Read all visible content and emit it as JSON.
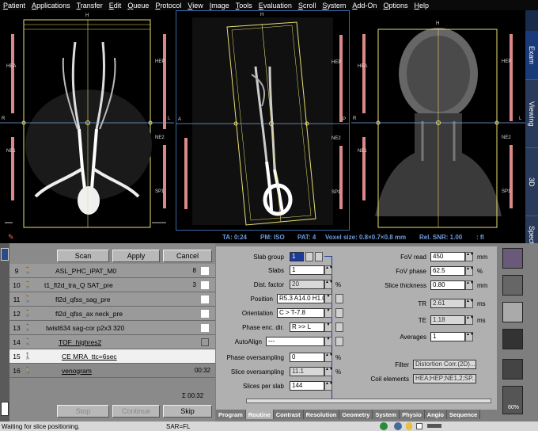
{
  "menu": [
    "Patient",
    "Applications",
    "Transfer",
    "Edit",
    "Queue",
    "Protocol",
    "View",
    "Image",
    "Tools",
    "Evaluation",
    "Scroll",
    "System",
    "Add-On",
    "Options",
    "Help"
  ],
  "viewports": [
    {
      "top_label": "H",
      "left_labels": [
        "HEA",
        "NE1"
      ],
      "right_labels": [
        "HEP",
        "NE2",
        "SP1"
      ],
      "side_labels": [
        "R",
        "L"
      ]
    },
    {
      "top_label": "H",
      "left_labels": [
        "A"
      ],
      "right_labels": [
        "HEP",
        "NE2",
        "SP1"
      ],
      "side_labels": [
        "A",
        "P"
      ]
    },
    {
      "top_label": "H",
      "left_labels": [
        "HEA",
        "NE1"
      ],
      "right_labels": [
        "HEP",
        "NE2",
        "SP1"
      ],
      "side_labels": [
        "R",
        "L"
      ]
    }
  ],
  "side_tabs": [
    "Exam",
    "Viewing",
    "3D",
    "Spectroscopy"
  ],
  "info": {
    "ta": "TA: 0:24",
    "pm": "PM: ISO",
    "pat": "PAT: 4",
    "voxel": "Voxel size: 0.8×0.7×0.8 mm",
    "snr": "Rel. SNR: 1.00",
    "mode": ": fl"
  },
  "queue": {
    "buttons": {
      "scan": "Scan",
      "apply": "Apply",
      "cancel": "Cancel",
      "stop": "Stop",
      "continue": "Continue",
      "skip": "Skip"
    },
    "rows": [
      {
        "num": "9",
        "name": "ASL_PHC_iPAT_M0",
        "extra": "8"
      },
      {
        "num": "10",
        "name": "t1_fl2d_tra_Q SAT_pre",
        "extra": "3"
      },
      {
        "num": "11",
        "name": "fl2d_qfss_sag_pre",
        "extra": ""
      },
      {
        "num": "12",
        "name": "fl2d_qfss_ax neck_pre",
        "extra": ""
      },
      {
        "num": "13",
        "name": "twist634 sag-cor p2x3 320",
        "extra": ""
      },
      {
        "num": "14",
        "name": "TOF_highres2",
        "extra": ""
      },
      {
        "num": "15",
        "name": "CE MRA_ttc=6sec",
        "extra": ""
      },
      {
        "num": "16",
        "name": "venogram",
        "extra": "00:32"
      }
    ],
    "total": "Σ 00:32"
  },
  "params": {
    "left": [
      {
        "label": "Slab group",
        "value": "1"
      },
      {
        "label": "Slabs",
        "value": "1"
      },
      {
        "label": "Dist. factor",
        "value": "20",
        "unit": "%"
      },
      {
        "label": "Position",
        "value": "R5.3 A14.0 H1.0"
      },
      {
        "label": "Orientation",
        "value": "C > T-7.8"
      },
      {
        "label": "Phase enc. dir.",
        "value": "R >> L"
      },
      {
        "label": "AutoAlign",
        "value": "---"
      },
      {
        "label": "Phase oversampling",
        "value": "0",
        "unit": "%"
      },
      {
        "label": "Slice oversampling",
        "value": "11.1",
        "unit": "%"
      },
      {
        "label": "Slices per slab",
        "value": "144"
      }
    ],
    "right": [
      {
        "label": "FoV read",
        "value": "450",
        "unit": "mm"
      },
      {
        "label": "FoV phase",
        "value": "62.5",
        "unit": "%"
      },
      {
        "label": "Slice thickness",
        "value": "0.80",
        "unit": "mm"
      },
      {
        "label": "TR",
        "value": "2.61",
        "unit": "ms"
      },
      {
        "label": "TE",
        "value": "1.18",
        "unit": "ms"
      },
      {
        "label": "Averages",
        "value": "1"
      }
    ],
    "filter_label": "Filter",
    "filter_value": "Distortion Corr.(2D)...",
    "coil_label": "Coil elements",
    "coil_value": "HEA;HEP;NE1,2;SP..."
  },
  "card_tabs": [
    "Program",
    "Routine",
    "Contrast",
    "Resolution",
    "Geometry",
    "System",
    "Physio",
    "Angio",
    "Sequence"
  ],
  "right_tools": {
    "battery": "60%"
  },
  "status": {
    "message": "Waiting for slice positioning.",
    "sar": "SAR=FL"
  },
  "colors": {
    "accent": "#3a6aa8",
    "info": "#6f9ad8",
    "slab": "#e8e070",
    "panel": "#b0b0b0"
  }
}
